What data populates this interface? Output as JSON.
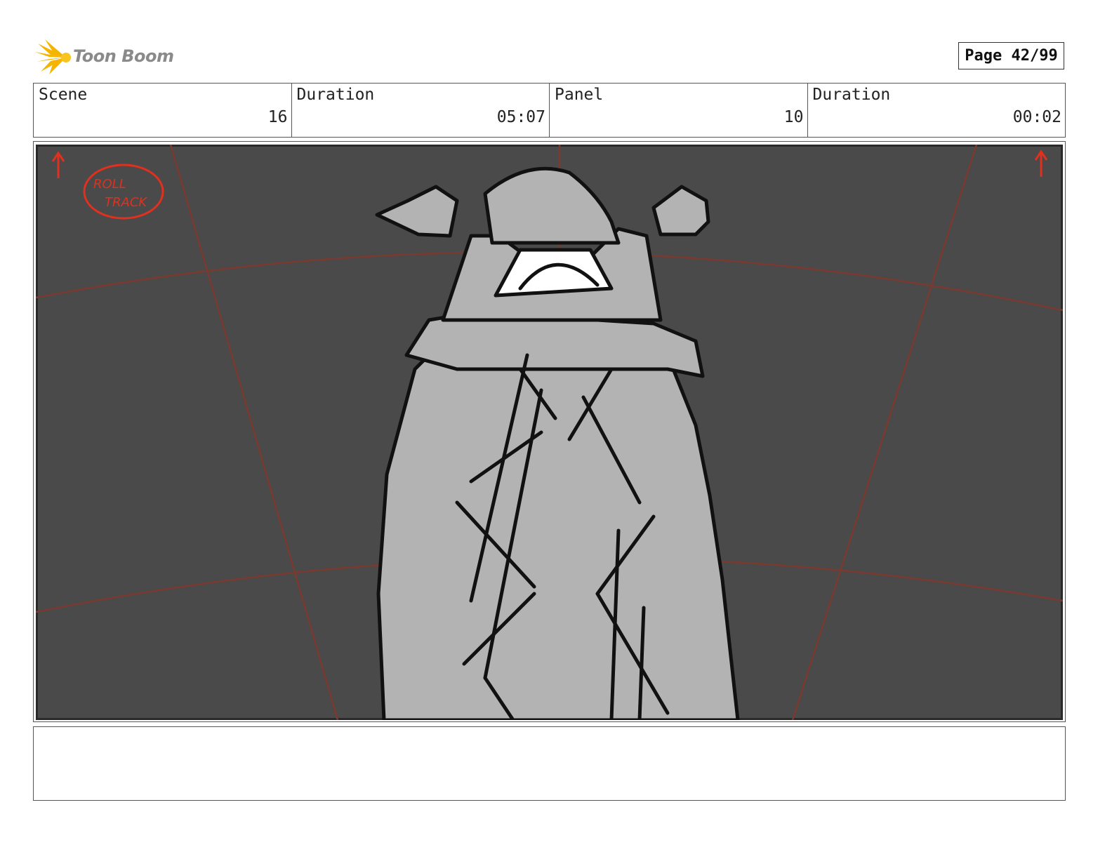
{
  "header": {
    "logo_text": "Toon Boom",
    "page_label": "Page 42/99"
  },
  "info": {
    "scene_label": "Scene",
    "scene_value": "16",
    "scene_duration_label": "Duration",
    "scene_duration_value": "05:07",
    "panel_label": "Panel",
    "panel_value": "10",
    "panel_duration_label": "Duration",
    "panel_duration_value": "00:02"
  },
  "panel": {
    "annotation": "ROLL TRACK"
  },
  "notes": {
    "text": ""
  },
  "colors": {
    "logo_accent": "#f5b400",
    "background_fill": "#4a4a4a",
    "figure_fill": "#b3b3b3",
    "annotation_red": "#e0301e",
    "grid_line": "#7a3a30"
  }
}
